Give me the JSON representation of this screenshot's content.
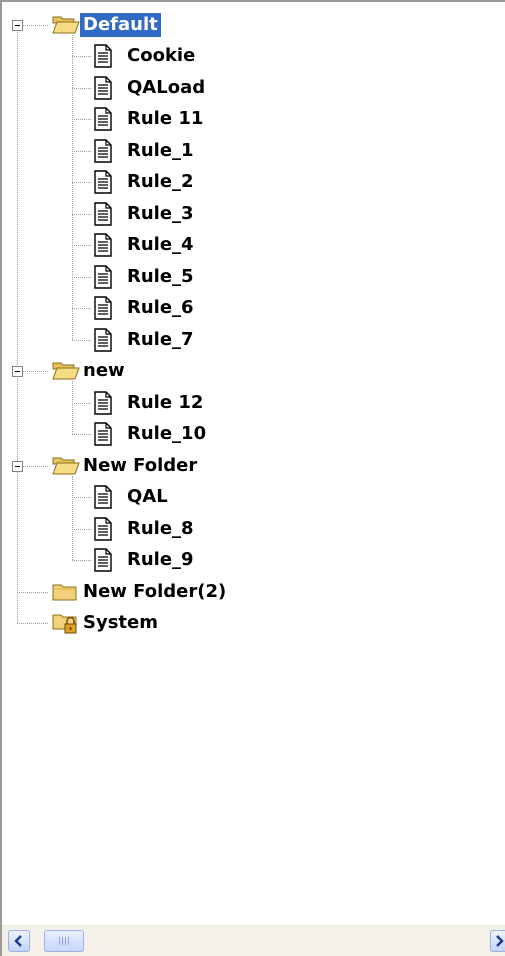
{
  "tree": {
    "nodes": [
      {
        "label": "Default",
        "type": "folder-open",
        "level": 0,
        "expanded": true,
        "selected": true
      },
      {
        "label": "Cookie",
        "type": "document",
        "level": 1
      },
      {
        "label": "QALoad",
        "type": "document",
        "level": 1
      },
      {
        "label": "Rule 11",
        "type": "document",
        "level": 1
      },
      {
        "label": "Rule_1",
        "type": "document",
        "level": 1
      },
      {
        "label": "Rule_2",
        "type": "document",
        "level": 1
      },
      {
        "label": "Rule_3",
        "type": "document",
        "level": 1
      },
      {
        "label": "Rule_4",
        "type": "document",
        "level": 1
      },
      {
        "label": "Rule_5",
        "type": "document",
        "level": 1
      },
      {
        "label": "Rule_6",
        "type": "document",
        "level": 1
      },
      {
        "label": "Rule_7",
        "type": "document",
        "level": 1
      },
      {
        "label": "new",
        "type": "folder-open",
        "level": 0,
        "expanded": true
      },
      {
        "label": "Rule 12",
        "type": "document",
        "level": 1
      },
      {
        "label": "Rule_10",
        "type": "document",
        "level": 1
      },
      {
        "label": "New Folder",
        "type": "folder-open",
        "level": 0,
        "expanded": true
      },
      {
        "label": "QAL",
        "type": "document",
        "level": 1
      },
      {
        "label": "Rule_8",
        "type": "document",
        "level": 1
      },
      {
        "label": "Rule_9",
        "type": "document",
        "level": 1
      },
      {
        "label": "New Folder(2)",
        "type": "folder-closed",
        "level": 0
      },
      {
        "label": "System",
        "type": "folder-locked",
        "level": 0
      }
    ]
  },
  "scrollbar": {
    "left_icon": "chevron-left-icon",
    "right_icon": "chevron-right-icon",
    "position": 0
  },
  "colors": {
    "selection": "#316ac5",
    "folder": "#f1d27a"
  }
}
